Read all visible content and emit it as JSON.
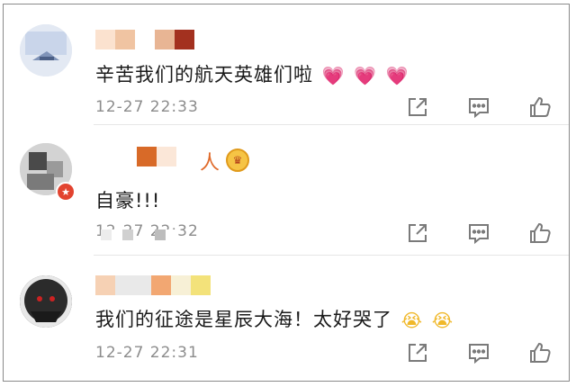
{
  "comments": [
    {
      "text": "辛苦我们的航天英雄们啦",
      "emojis": [
        "💗",
        "💗",
        "💗"
      ],
      "time": "12-27 22:33"
    },
    {
      "name_suffix": "人",
      "text": "自豪!!!",
      "time": "12-27 22:32"
    },
    {
      "text": "我们的征途是星辰大海！太好哭了",
      "emojis": [
        "😭",
        "😭"
      ],
      "time": "12-27 22:31"
    }
  ],
  "actions": {
    "icons": [
      "share-icon",
      "comment-icon",
      "like-icon"
    ]
  },
  "colors": {
    "text": "#1a1a1a",
    "meta": "#8c8c8c",
    "icon": "#7a7a7a",
    "badge": "#e2432f"
  }
}
